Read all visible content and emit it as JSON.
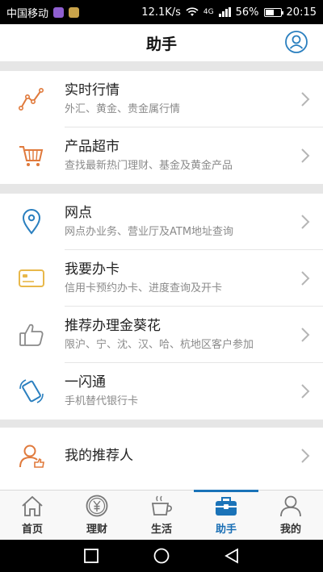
{
  "status_bar": {
    "carrier": "中国移动",
    "network_speed": "12.1K/s",
    "network_type": "4G",
    "battery": "56%",
    "battery_level": 0.56,
    "time": "20:15"
  },
  "header": {
    "title": "助手",
    "profile_icon": "user-circle-icon"
  },
  "sections": [
    {
      "items": [
        {
          "icon": "line-chart-icon",
          "title": "实时行情",
          "subtitle": "外汇、黄金、贵金属行情"
        },
        {
          "icon": "shopping-cart-icon",
          "title": "产品超市",
          "subtitle": "查找最新热门理财、基金及黄金产品"
        }
      ]
    },
    {
      "items": [
        {
          "icon": "location-pin-icon",
          "title": "网点",
          "subtitle": "网点办业务、营业厅及ATM地址查询"
        },
        {
          "icon": "bank-card-icon",
          "title": "我要办卡",
          "subtitle": "信用卡预约办卡、进度查询及开卡"
        },
        {
          "icon": "thumbs-up-icon",
          "title": "推荐办理金葵花",
          "subtitle": "限沪、宁、沈、汉、哈、杭地区客户参加"
        },
        {
          "icon": "phone-swipe-icon",
          "title": "一闪通",
          "subtitle": "手机替代银行卡"
        }
      ]
    },
    {
      "items": [
        {
          "icon": "referrer-icon",
          "title": "我的推荐人",
          "subtitle": ""
        }
      ]
    }
  ],
  "tabs": [
    {
      "label": "首页",
      "icon": "home-icon",
      "active": false
    },
    {
      "label": "理财",
      "icon": "yuan-coin-icon",
      "active": false
    },
    {
      "label": "生活",
      "icon": "coffee-cup-icon",
      "active": false
    },
    {
      "label": "助手",
      "icon": "toolbox-icon",
      "active": true
    },
    {
      "label": "我的",
      "icon": "person-icon",
      "active": false
    }
  ],
  "colors": {
    "accent": "#1a73b8",
    "orange_icon": "#e07a3c",
    "blue_icon": "#2a7fbf",
    "gold_icon": "#e8b84a",
    "gray_icon": "#8a8a8a"
  }
}
